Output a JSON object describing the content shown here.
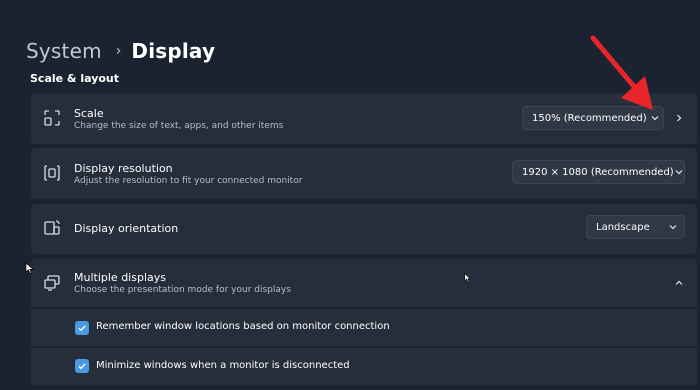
{
  "breadcrumb": {
    "parent": "System",
    "separator": "›",
    "current": "Display"
  },
  "section": {
    "title": "Scale & layout"
  },
  "scale": {
    "title": "Scale",
    "subtitle": "Change the size of text, apps, and other items",
    "value": "150% (Recommended)",
    "icon": "scale-icon"
  },
  "resolution": {
    "title": "Display resolution",
    "subtitle": "Adjust the resolution to fit your connected monitor",
    "value": "1920 × 1080 (Recommended)",
    "icon": "resolution-icon"
  },
  "orientation": {
    "title": "Display orientation",
    "value": "Landscape",
    "icon": "orientation-icon"
  },
  "multiple_displays": {
    "title": "Multiple displays",
    "subtitle": "Choose the presentation mode for your displays",
    "icon": "multiple-displays-icon",
    "expanded": true,
    "options": [
      {
        "label": "Remember window locations based on monitor connection",
        "checked": true
      },
      {
        "label": "Minimize windows when a monitor is disconnected",
        "checked": true
      }
    ]
  },
  "colors": {
    "background": "#1b2330",
    "card": "#262e3b",
    "accent": "#4a9ae2",
    "annotation_arrow": "#e8262a"
  }
}
